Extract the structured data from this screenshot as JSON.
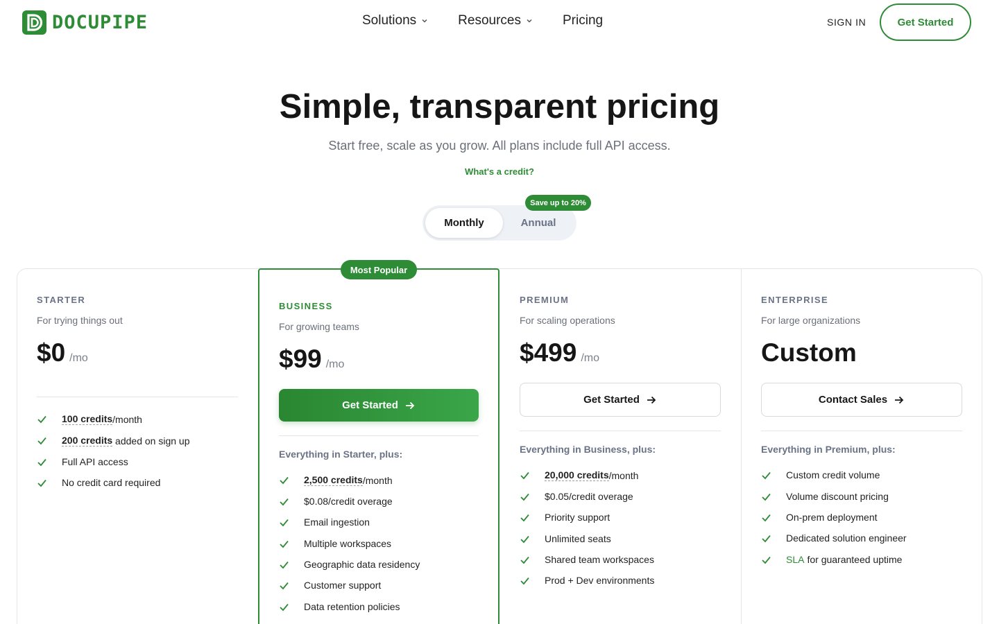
{
  "brand": {
    "name": "DOCUPIPE",
    "color": "#2e8b36"
  },
  "nav": {
    "links": [
      {
        "label": "Solutions",
        "dropdown": true
      },
      {
        "label": "Resources",
        "dropdown": true
      },
      {
        "label": "Pricing",
        "dropdown": false
      }
    ],
    "sign_in": "SIGN IN",
    "get_started": "Get Started"
  },
  "hero": {
    "title": "Simple, transparent pricing",
    "subtitle": "Start free, scale as you grow. All plans include full API access.",
    "credit_link": "What's a credit?"
  },
  "billing_toggle": {
    "monthly": "Monthly",
    "annual": "Annual",
    "selected": "Monthly",
    "save_badge": "Save up to 20%"
  },
  "plans": [
    {
      "tier": "STARTER",
      "description": "For trying things out",
      "price": "$0",
      "per": "/mo",
      "features": [
        {
          "credits": "100 credits",
          "text": "/month"
        },
        {
          "credits": "200 credits",
          "text": " added on sign up"
        },
        {
          "text": "Full API access"
        },
        {
          "text": "No credit card required"
        }
      ]
    },
    {
      "tier": "BUSINESS",
      "badge": "Most Popular",
      "description": "For growing teams",
      "price": "$99",
      "per": "/mo",
      "cta": "Get Started",
      "includes": "Everything in Starter, plus:",
      "features": [
        {
          "credits": "2,500 credits",
          "text": "/month"
        },
        {
          "text": "$0.08/credit overage"
        },
        {
          "text": "Email ingestion"
        },
        {
          "text": "Multiple workspaces"
        },
        {
          "text": "Geographic data residency"
        },
        {
          "text": "Customer support"
        },
        {
          "text": "Data retention policies"
        }
      ]
    },
    {
      "tier": "PREMIUM",
      "description": "For scaling operations",
      "price": "$499",
      "per": "/mo",
      "cta": "Get Started",
      "includes": "Everything in Business, plus:",
      "features": [
        {
          "credits": "20,000 credits",
          "text": "/month"
        },
        {
          "text": "$0.05/credit overage"
        },
        {
          "text": "Priority support"
        },
        {
          "text": "Unlimited seats"
        },
        {
          "text": "Shared team workspaces"
        },
        {
          "text": "Prod + Dev environments"
        }
      ]
    },
    {
      "tier": "ENTERPRISE",
      "description": "For large organizations",
      "price": "Custom",
      "cta": "Contact Sales",
      "includes": "Everything in Premium, plus:",
      "features": [
        {
          "text": "Custom credit volume"
        },
        {
          "text": "Volume discount pricing"
        },
        {
          "text": "On-prem deployment"
        },
        {
          "text": "Dedicated solution engineer"
        },
        {
          "link": "SLA",
          "text": "for guaranteed uptime"
        }
      ]
    }
  ]
}
